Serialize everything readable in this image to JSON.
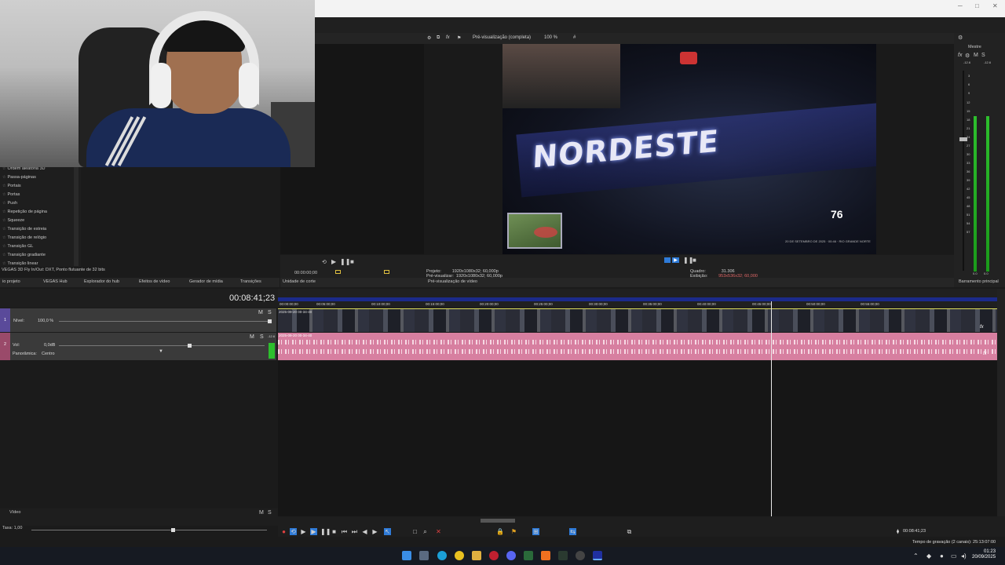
{
  "window": {
    "min": "─",
    "max": "□",
    "close": "✕"
  },
  "transitions": {
    "items": [
      "Ordem aleatória 3D",
      "Passa-páginas",
      "Portais",
      "Portas",
      "Push",
      "Repetição de página",
      "Squeeze",
      "Transição de estreia",
      "Transição de relógio",
      "Transição GL",
      "Transição gradiante",
      "Transição linear"
    ],
    "status": "VEGAS 3D Fly In/Out: DXT, Ponto flutuante de 32 bits"
  },
  "dock_tabs": [
    "io projeto",
    "VEGAS Hub",
    "Explorador do hub",
    "Efeitos de vídeo",
    "Gerador de mídia",
    "Transições"
  ],
  "trimmer": {
    "timecode": "00:00:00;00",
    "tab": "Unidade de corte"
  },
  "preview": {
    "quality": "Pré-visualização (completa)",
    "zoom": "100 %",
    "overlay_text": "NORDESTE",
    "speed": "76",
    "hud_text": "20 DE SETEMBRO DE 2025 · 00:46 · RIO GRANDE NORTE",
    "projeto_label": "Projeto:",
    "projeto_value": "1920x1080x32; 60,000p",
    "previsualizar_label": "Pré-visualizar:",
    "previsualizar_value": "1920x1080x32; 60,000p",
    "quadro_label": "Quadro:",
    "quadro_value": "31.306",
    "exibicao_label": "Exibição:",
    "exibicao_value": "953x536x32; 60,000",
    "tab": "Pré-visualização de vídeo"
  },
  "master": {
    "label": "Mestre",
    "tab": "Barramento principal",
    "scale": [
      "-12.6",
      "-12.6",
      "3",
      "6",
      "9",
      "12",
      "15",
      "18",
      "21",
      "24",
      "27",
      "30",
      "33",
      "36",
      "39",
      "42",
      "45",
      "48",
      "51",
      "54",
      "57",
      "0.0",
      "0.0"
    ],
    "meter_color": "#2dbf2d"
  },
  "timeline": {
    "timecode": "00:08:41;23",
    "ticks": [
      "00:00:00;00",
      "00:05:00;00",
      "00:10:00;00",
      "00:15:00;00",
      "00:20:00;00",
      "00:25:00;00",
      "00:30:00;00",
      "00:35:00;00",
      "00:40:00;00",
      "00:45:00;00",
      "00:50:00;00",
      "00:55:00;00"
    ],
    "video_track": {
      "num": "1",
      "ms": "M",
      "s": "S",
      "nivel_label": "Nível:",
      "nivel_value": "100,0 %",
      "clip": "2025-09-20 00-34-40"
    },
    "audio_track": {
      "num": "2",
      "ms": "M",
      "s": "S",
      "vol_label": "Vol:",
      "vol_value": "0,0dB",
      "pan_label": "Panorâmica:",
      "pan_value": "Centro",
      "clip": "2025-09-20 00-34-40",
      "level": "-12.6"
    },
    "clip_fx": "fx",
    "video_color": "#2b2e3a",
    "audio_color": "#d77fa0"
  },
  "bottom": {
    "video_label": "Vídeo",
    "taxa": "Taxa: 1,00",
    "timecode": "00:08:41;23",
    "rec_time": "Tempo de gravação (2 canais): 25:13:07:00"
  },
  "taskbar": {
    "time": "01:23",
    "date": "20/09/2025"
  }
}
